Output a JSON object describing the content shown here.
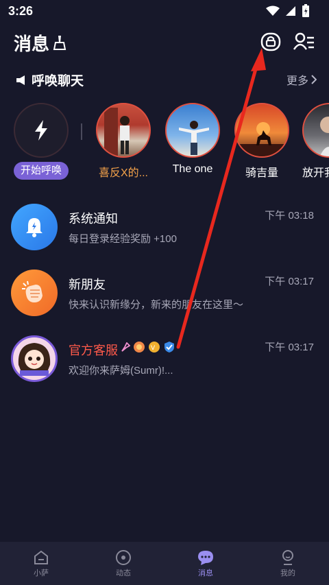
{
  "status": {
    "time": "3:26"
  },
  "header": {
    "title": "消息"
  },
  "call": {
    "title": "呼唤聊天",
    "more": "更多"
  },
  "stories": [
    {
      "label": "开始呼唤"
    },
    {
      "label": "喜反X的..."
    },
    {
      "label": "The one"
    },
    {
      "label": "骑吉量"
    },
    {
      "label": "放开我"
    }
  ],
  "messages": [
    {
      "title": "系统通知",
      "subtitle": "每日登录经验奖励 +100",
      "time": "下午 03:18"
    },
    {
      "title": "新朋友",
      "subtitle": "快来认识新缘分，新来的朋友在这里～",
      "time": "下午 03:17"
    },
    {
      "title": "官方客服",
      "subtitle": "欢迎你来萨姆(Sumr)!...",
      "time": "下午 03:17"
    }
  ],
  "nav": [
    {
      "label": "小萨"
    },
    {
      "label": "动态"
    },
    {
      "label": "消息"
    },
    {
      "label": "我的"
    }
  ],
  "colors": {
    "background": "#17182a",
    "accent": "#7a62d6",
    "annotation_arrow": "#e8281e"
  }
}
